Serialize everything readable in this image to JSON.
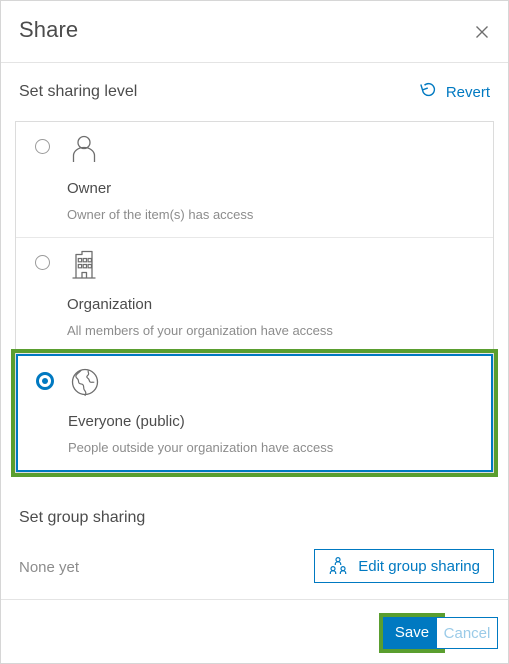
{
  "dialog": {
    "title": "Share",
    "close_icon": "close-icon"
  },
  "sharing_level": {
    "section_title": "Set sharing level",
    "revert": {
      "label": "Revert",
      "icon": "revert-circular-arrow-icon"
    },
    "options": [
      {
        "label": "Owner",
        "description": "Owner of the item(s) has access",
        "icon": "person-icon",
        "selected": false
      },
      {
        "label": "Organization",
        "description": "All members of your organization have access",
        "icon": "building-icon",
        "selected": false
      },
      {
        "label": "Everyone (public)",
        "description": "People outside your organization have access",
        "icon": "globe-icon",
        "selected": true
      }
    ]
  },
  "group_sharing": {
    "section_title": "Set group sharing",
    "none_text": "None yet",
    "edit_button": {
      "label": "Edit group sharing",
      "icon": "group-people-icon"
    }
  },
  "footer": {
    "save_label": "Save",
    "cancel_label": "Cancel"
  },
  "colors": {
    "accent_blue": "#0079c1",
    "highlight_green": "#5a9e2f",
    "text_primary": "#4c4c4c",
    "text_secondary": "#8c8c8c",
    "border": "#dcdcdc"
  }
}
